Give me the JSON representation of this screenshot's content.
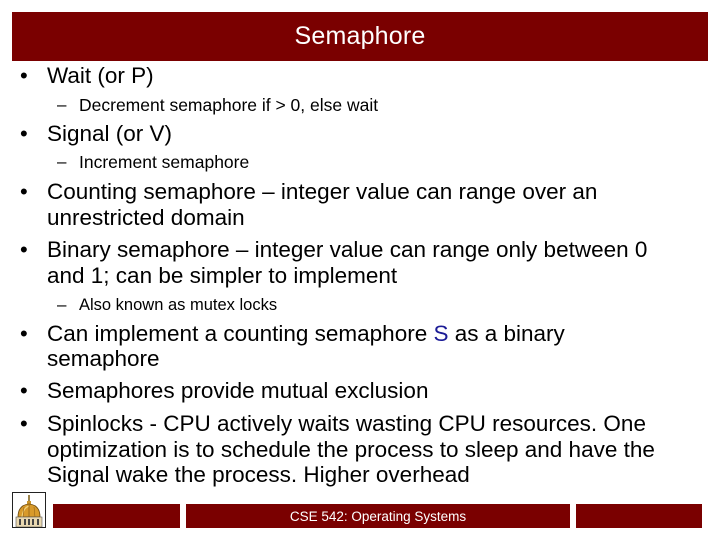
{
  "slide": {
    "title": "Semaphore",
    "bullets": [
      {
        "text": "Wait (or P)",
        "subitems": [
          "Decrement semaphore if > 0, else wait"
        ]
      },
      {
        "text": "Signal (or V)",
        "subitems": [
          "Increment semaphore"
        ]
      },
      {
        "lines": [
          "Counting semaphore – integer value can range over an",
          "unrestricted domain"
        ]
      },
      {
        "lines": [
          "Binary semaphore – integer value can range only between 0",
          "and 1; can be simpler to implement"
        ],
        "subitems": [
          "Also known as mutex locks"
        ]
      },
      {
        "line1_before": "Can implement a counting semaphore ",
        "line1_accent": "S",
        "line1_after": " as a binary",
        "line2": "semaphore"
      },
      {
        "text": "Semaphores provide mutual exclusion"
      },
      {
        "lines": [
          "Spinlocks  - CPU actively waits wasting CPU resources. One",
          "optimization is to schedule the process to sleep and have the",
          "Signal wake the process. Higher overhead"
        ]
      }
    ],
    "bullet_glyph": "•",
    "dash_glyph": "–"
  },
  "footer": {
    "course": "CSE 542: Operating Systems",
    "logo_icon": "dome-logo-icon"
  },
  "colors": {
    "brand": "#7a0000",
    "accent": "#1c1c96"
  }
}
